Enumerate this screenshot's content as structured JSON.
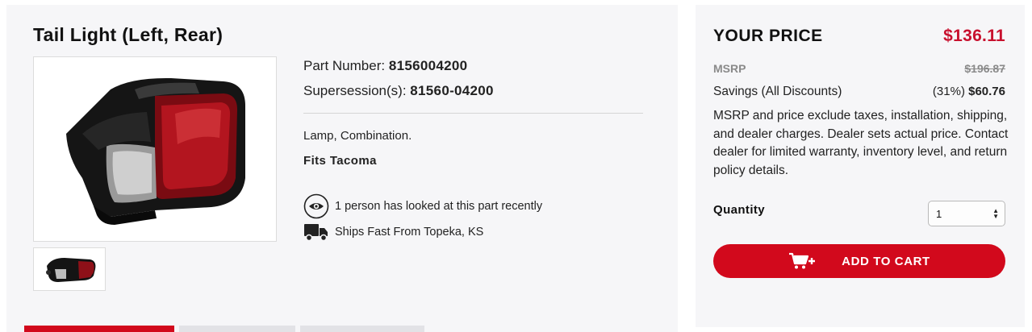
{
  "product": {
    "title": "Tail Light (Left, Rear)",
    "part_number_label": "Part Number:",
    "part_number": "8156004200",
    "supersession_label": "Supersession(s):",
    "supersession": "81560-04200",
    "description": "Lamp, Combination.",
    "fits": "Fits Tacoma",
    "views_text": "1 person has looked at this part recently",
    "shipping_text": "Ships Fast From Topeka, KS",
    "icons": [
      "eye-icon",
      "truck-icon"
    ]
  },
  "pricing": {
    "your_price_label": "YOUR PRICE",
    "price": "$136.11",
    "msrp_label": "MSRP",
    "msrp": "$196.87",
    "savings_label": "Savings (All Discounts)",
    "savings_percent": "(31%)",
    "savings_amount": "$60.76",
    "disclaimer": "MSRP and price exclude taxes, installation, shipping, and dealer charges. Dealer sets actual price. Contact dealer for limited warranty, inventory level, and return policy details.",
    "quantity_label": "Quantity",
    "quantity_value": "1",
    "add_to_cart_label": "ADD TO CART"
  },
  "colors": {
    "accent_red": "#d2091c",
    "price_red": "#c8102e",
    "panel_bg": "#f6f6f8"
  }
}
